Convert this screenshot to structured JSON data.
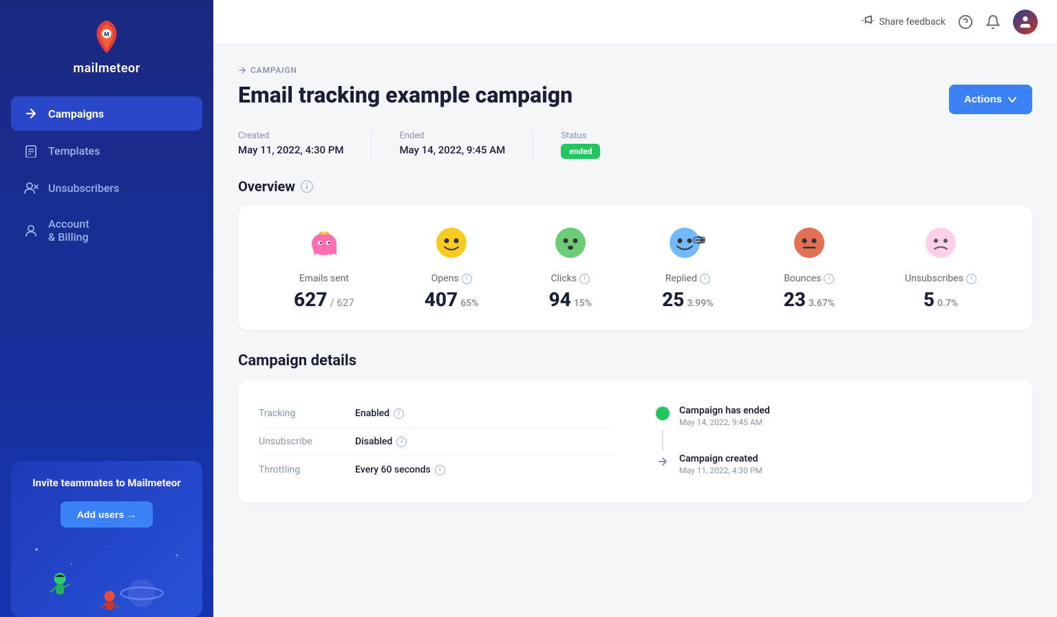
{
  "sidebar": {
    "logo_text": "mailmeteor",
    "nav_items": [
      {
        "id": "campaigns",
        "label": "Campaigns",
        "icon": "arrow-right",
        "active": true
      },
      {
        "id": "templates",
        "label": "Templates",
        "icon": "document",
        "active": false
      },
      {
        "id": "unsubscribers",
        "label": "Unsubscribers",
        "icon": "people",
        "active": false
      },
      {
        "id": "account-billing",
        "label": "Account & Billing",
        "icon": "person",
        "active": false
      }
    ],
    "invite_title": "Invite teammates to Mailmeteor",
    "add_users_label": "Add users →"
  },
  "topbar": {
    "share_feedback_label": "Share feedback",
    "help_icon": "question-circle",
    "bell_icon": "bell",
    "avatar_icon": "user-avatar"
  },
  "campaign": {
    "breadcrumb": "CAMPAIGN",
    "title": "Email tracking example campaign",
    "actions_label": "Actions",
    "meta": {
      "created_label": "Created",
      "created_value": "May 11, 2022, 4:30 PM",
      "ended_label": "Ended",
      "ended_value": "May 14, 2022, 9:45 AM",
      "status_label": "Status",
      "status_value": "ended"
    },
    "overview": {
      "title": "Overview",
      "stats": [
        {
          "id": "emails-sent",
          "emoji": "😊",
          "emoji_style": "pink",
          "label": "Emails sent",
          "value": "627",
          "sub": "/ 627",
          "pct": ""
        },
        {
          "id": "opens",
          "emoji": "😊",
          "emoji_style": "yellow",
          "label": "Opens",
          "value": "407",
          "sub": "",
          "pct": "65%"
        },
        {
          "id": "clicks",
          "emoji": "😮",
          "emoji_style": "green",
          "label": "Clicks",
          "value": "94",
          "sub": "",
          "pct": "15%"
        },
        {
          "id": "replied",
          "emoji": "😄",
          "emoji_style": "blue",
          "label": "Replied",
          "value": "25",
          "sub": "",
          "pct": "3.99%"
        },
        {
          "id": "bounces",
          "emoji": "😐",
          "emoji_style": "red",
          "label": "Bounces",
          "value": "23",
          "sub": "",
          "pct": "3.67%"
        },
        {
          "id": "unsubscribes",
          "emoji": "☹",
          "emoji_style": "pink-light",
          "label": "Unsubscribes",
          "value": "5",
          "sub": "",
          "pct": "0.7%"
        }
      ]
    },
    "details": {
      "title": "Campaign details",
      "rows": [
        {
          "key": "Tracking",
          "value": "Enabled",
          "has_info": true
        },
        {
          "key": "Unsubscribe",
          "value": "Disabled",
          "has_info": true
        },
        {
          "key": "Throttling",
          "value": "Every 60 seconds",
          "has_info": true
        }
      ],
      "timeline": [
        {
          "type": "dot-green",
          "title": "Campaign has ended",
          "date": "May 14, 2022, 9:45 AM"
        },
        {
          "type": "arrow-gray",
          "title": "Campaign created",
          "date": "May 11, 2022, 4:30 PM"
        }
      ]
    }
  }
}
